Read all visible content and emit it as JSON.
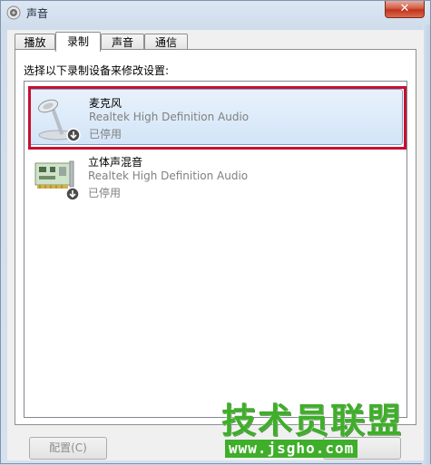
{
  "window": {
    "title": "声音",
    "close_label": "✕"
  },
  "tabs": [
    {
      "label": "播放",
      "active": false
    },
    {
      "label": "录制",
      "active": true
    },
    {
      "label": "声音",
      "active": false
    },
    {
      "label": "通信",
      "active": false
    }
  ],
  "panel": {
    "instruction": "选择以下录制设备来修改设置:"
  },
  "devices": [
    {
      "name": "麦克风",
      "driver": "Realtek High Definition Audio",
      "status": "已停用",
      "icon": "microphone-icon",
      "selected": true
    },
    {
      "name": "立体声混音",
      "driver": "Realtek High Definition Audio",
      "status": "已停用",
      "icon": "sound-card-icon",
      "selected": false
    }
  ],
  "buttons": {
    "configure": "配置(C)"
  },
  "watermark": {
    "main": "技术员联盟",
    "url": "www.jsgho.com"
  },
  "colors": {
    "highlight": "#c8102e",
    "watermark": "#3fae2a"
  }
}
